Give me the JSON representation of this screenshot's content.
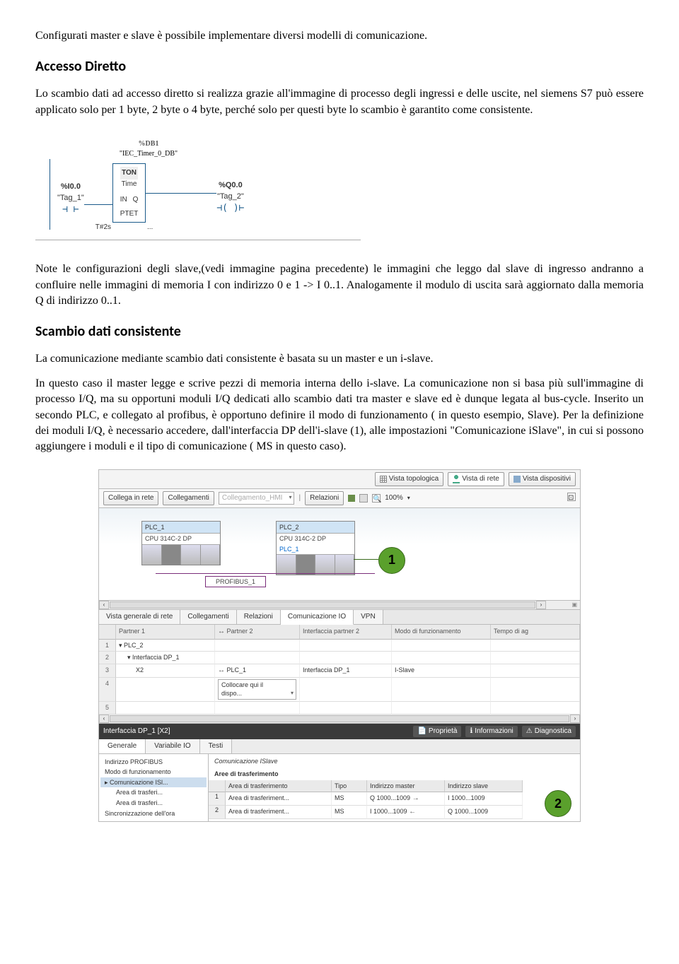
{
  "para1": "Configurati master e slave è possibile implementare diversi modelli di comunicazione.",
  "h_accesso": "Accesso Diretto",
  "para2": "Lo scambio dati ad accesso diretto si realizza grazie all'immagine di processo degli ingressi e delle uscite, nel siemens S7 può essere applicato solo per 1 byte, 2 byte o 4 byte, perché solo per questi byte lo scambio è garantito come consistente.",
  "ladder": {
    "db": "%DB1",
    "db_name": "\"IEC_Timer_0_DB\"",
    "in_addr": "%I0.0",
    "in_name": "\"Tag_1\"",
    "block_top": "TON",
    "block_sub": "Time",
    "pin_in": "IN",
    "pin_q": "Q",
    "pin_pt": "PT",
    "pin_et": "ET",
    "pt_val": "T#2s",
    "et_val": "...",
    "out_addr": "%Q0.0",
    "out_name": "\"Tag_2\""
  },
  "para3": "Note le configurazioni degli slave,(vedi immagine pagina precedente) le immagini che leggo dal slave di ingresso andranno a confluire nelle immagini di memoria I con indirizzo 0 e 1 -> I 0..1. Analogamente il modulo di uscita sarà aggiornato dalla memoria Q di indirizzo 0..1.",
  "h_scambio": "Scambio dati consistente",
  "para4": "La comunicazione mediante scambio dati consistente è basata su un master e un i-slave.",
  "para5": "In questo caso il master legge e scrive pezzi di memoria interna dello i-slave. La comunicazione non si basa più sull'immagine di processo I/Q, ma su opportuni moduli I/Q dedicati allo scambio dati tra master e slave ed è dunque legata al bus-cycle. Inserito un secondo PLC, e collegato al profibus, è opportuno definire il modo di funzionamento ( in questo esempio, Slave). Per la definizione dei moduli I/Q, è necessario accedere, dall'interfaccia DP dell'i-slave (1), alle impostazioni \"Comunicazione iSlave\", in cui si possono aggiungere i moduli e il tipo di comunicazione ( MS in questo caso).",
  "screenshot": {
    "topbar": {
      "vista_topologica": "Vista topologica",
      "vista_rete": "Vista di rete",
      "vista_dispositivi": "Vista dispositivi"
    },
    "toolbar": {
      "collega": "Collega in rete",
      "collegamenti": "Collegamenti",
      "collegamento_hmi": "Collegamento_HMI",
      "relazioni": "Relazioni",
      "zoom": "100%"
    },
    "plc1": {
      "name": "PLC_1",
      "cpu": "CPU 314C-2 DP"
    },
    "plc2": {
      "name": "PLC_2",
      "cpu": "CPU 314C-2 DP",
      "sub": "PLC_1"
    },
    "bus": "PROFIBUS_1",
    "callout1": "1",
    "tabs2": {
      "vista_generale": "Vista generale di rete",
      "collegamenti": "Collegamenti",
      "relazioni": "Relazioni",
      "comunicazione_io": "Comunicazione IO",
      "vpn": "VPN"
    },
    "gridHeaders": {
      "partner1": "Partner 1",
      "partner2": "Partner 2",
      "interfaccia_p2": "Interfaccia partner 2",
      "modo": "Modo di funzionamento",
      "tempo": "Tempo di ag"
    },
    "gridRows": [
      {
        "n": "1",
        "p1": "▾ PLC_2",
        "p2": "",
        "ip2": "",
        "modo": "",
        "t": ""
      },
      {
        "n": "2",
        "p1": "▾ Interfaccia DP_1",
        "p2": "",
        "ip2": "",
        "modo": "",
        "t": ""
      },
      {
        "n": "3",
        "p1": "X2",
        "p2": "PLC_1",
        "ip2": "Interfaccia DP_1",
        "modo": "I-Slave",
        "t": ""
      },
      {
        "n": "4",
        "p1": "",
        "p2": "Collocare qui il dispo...",
        "ip2": "",
        "modo": "",
        "t": ""
      },
      {
        "n": "5",
        "p1": "",
        "p2": "",
        "ip2": "",
        "modo": "",
        "t": ""
      }
    ],
    "titlebar": {
      "title": "Interfaccia DP_1 [X2]",
      "proprieta": "Proprietà",
      "informazioni": "Informazioni",
      "diagnostica": "Diagnostica"
    },
    "subtabs": {
      "generale": "Generale",
      "variabile_io": "Variabile IO",
      "testi": "Testi"
    },
    "tree": {
      "n1": "Indirizzo PROFIBUS",
      "n2": "Modo di funzionamento",
      "n3": "▸ Comunicazione ISl...",
      "n3a": "Area di trasferi...",
      "n3b": "Area di trasferi...",
      "n4": "Sincronizzazione dell'ora"
    },
    "panel": {
      "title": "Comunicazione ISlave",
      "subtitle": "Aree di trasferimento",
      "headers": {
        "area": "Area di trasferimento",
        "tipo": "Tipo",
        "ind_master": "Indirizzo master",
        "ind_slave": "Indirizzo slave"
      },
      "rows": [
        {
          "n": "1",
          "area": "Area di trasferiment...",
          "tipo": "MS",
          "im1": "Q 1000...1009",
          "arr1": "→",
          "is1": "I 1000...1009"
        },
        {
          "n": "2",
          "area": "Area di trasferiment...",
          "tipo": "MS",
          "im1": "I 1000...1009",
          "arr1": "←",
          "is1": "Q 1000...1009"
        }
      ]
    },
    "callout2": "2"
  }
}
